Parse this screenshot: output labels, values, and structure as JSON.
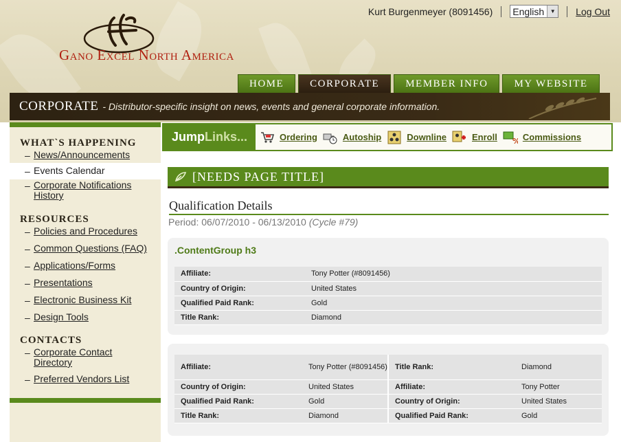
{
  "header": {
    "logo_text": "Gano Excel North America",
    "user": "Kurt Burgenmeyer (8091456)",
    "language": "English",
    "logout": "Log Out"
  },
  "nav": {
    "tabs": [
      {
        "label": "HOME",
        "active": false
      },
      {
        "label": "CORPORATE",
        "active": true
      },
      {
        "label": "MEMBER INFO",
        "active": false
      },
      {
        "label": "MY WEBSITE",
        "active": false
      }
    ]
  },
  "banner": {
    "title": "CORPORATE",
    "subtitle": "- Distributor-specific insight on news, events and general corporate information."
  },
  "sidebar": {
    "sections": [
      {
        "heading": "WHAT`S HAPPENING",
        "items": [
          "News/Announcements",
          "Events Calendar",
          "Corporate Notifications History"
        ]
      },
      {
        "heading": "RESOURCES",
        "items": [
          "Policies and Procedures",
          "Common Questions (FAQ)",
          "Applications/Forms",
          "Presentations",
          "Electronic Business Kit",
          "Design Tools"
        ]
      },
      {
        "heading": "CONTACTS",
        "items": [
          "Corporate Contact Directory",
          "Preferred Vendors List"
        ]
      }
    ]
  },
  "jumplinks": {
    "label_bold": "Jump",
    "label_dim": "Links...",
    "links": [
      "Ordering",
      "Autoship",
      "Downline",
      "Enroll",
      "Commissions"
    ]
  },
  "page": {
    "title": "[NEEDS PAGE TITLE]",
    "heading": "Qualification Details",
    "period": "Period: 06/07/2010 - 06/13/2010",
    "cycle": "(Cycle #79)"
  },
  "group1": {
    "title": ".ContentGroup h3",
    "rows": [
      {
        "label": "Affiliate:",
        "value": "Tony Potter (#8091456)"
      },
      {
        "label": "Country of Origin:",
        "value": "United States"
      },
      {
        "label": "Qualified Paid Rank:",
        "value": "Gold"
      },
      {
        "label": "Title Rank:",
        "value": "Diamond"
      }
    ]
  },
  "group2": {
    "rows": [
      {
        "l1": "Affiliate:",
        "v1": "Tony Potter (#8091456)",
        "l2": "Title Rank:",
        "v2": "Diamond"
      },
      {
        "l1": "Country of Origin:",
        "v1": "United States",
        "l2": "Affiliate:",
        "v2": "Tony Potter"
      },
      {
        "l1": "Qualified Paid Rank:",
        "v1": "Gold",
        "l2": "Country of Origin:",
        "v2": "United States"
      },
      {
        "l1": "Title Rank:",
        "v1": "Diamond",
        "l2": "Qualified Paid Rank:",
        "v2": "Gold"
      }
    ]
  },
  "colors": {
    "green": "#5a8a1c",
    "brown": "#2d2212",
    "logo_red": "#b02010"
  }
}
